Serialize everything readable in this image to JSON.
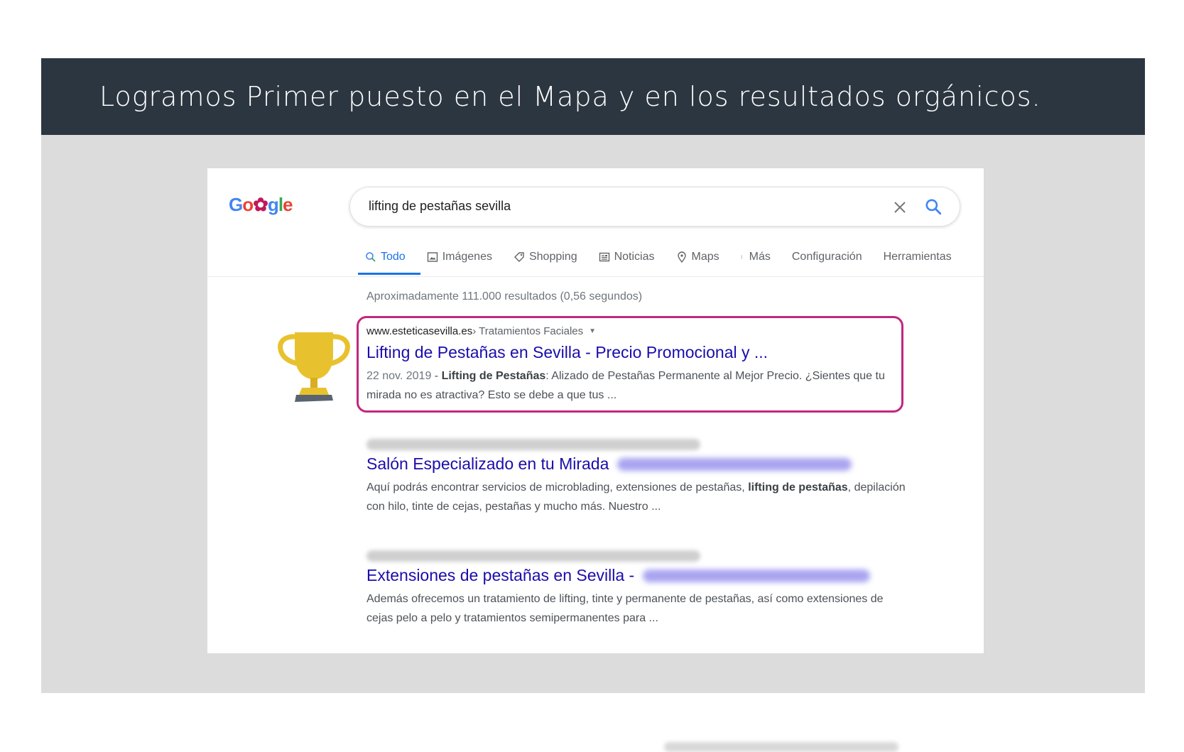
{
  "banner": {
    "title": "Logramos Primer puesto en el Mapa y en los resultados orgánicos."
  },
  "serp": {
    "logo": {
      "text_parts": [
        "G",
        "o",
        "✿",
        "g",
        "l",
        "e"
      ]
    },
    "search": {
      "query": "lifting de pestañas sevilla"
    },
    "tabs": [
      {
        "label": "Todo",
        "icon": "search-icon",
        "active": true
      },
      {
        "label": "Imágenes",
        "icon": "image-icon"
      },
      {
        "label": "Shopping",
        "icon": "tag-icon"
      },
      {
        "label": "Noticias",
        "icon": "news-icon"
      },
      {
        "label": "Maps",
        "icon": "map-pin-icon"
      },
      {
        "label": "Más",
        "icon": "more-vert-icon"
      },
      {
        "label": "Configuración"
      },
      {
        "label": "Herramientas"
      }
    ],
    "stats": "Aproximadamente 111.000 resultados (0,56 segundos)",
    "results": [
      {
        "domain": "www.esteticasevilla.es",
        "breadcrumb": "› Tratamientos Faciales",
        "title": "Lifting de Pestañas en Sevilla - Precio Promocional y ...",
        "date": "22 nov. 2019",
        "dash": " - ",
        "bold1": "Lifting de Pestañas",
        "text1": ": Alizado de Pestañas Permanente al Mejor Precio. ¿Sientes que tu mirada no es atractiva? Esto se debe a que tus ..."
      },
      {
        "title": "Salón Especializado en tu Mirada",
        "text1": "Aquí podrás encontrar servicios de microblading, extensiones de pestañas, ",
        "bold1": "lifting de pestañas",
        "text2": ", depilación con hilo, tinte de cejas, pestañas y mucho más. Nuestro ..."
      },
      {
        "title": "Extensiones de pestañas en Sevilla -",
        "text1": "Además ofrecemos un tratamiento de lifting, tinte y permanente de pestañas, así como extensiones de cejas pelo a pelo y tratamientos semipermanentes para ..."
      }
    ]
  },
  "colors": {
    "banner_bg": "#2c3640",
    "link_title": "#1a0dab",
    "highlight_border": "#c0287d",
    "trophy": "#e8c22e",
    "active_tab": "#1a73e8"
  }
}
